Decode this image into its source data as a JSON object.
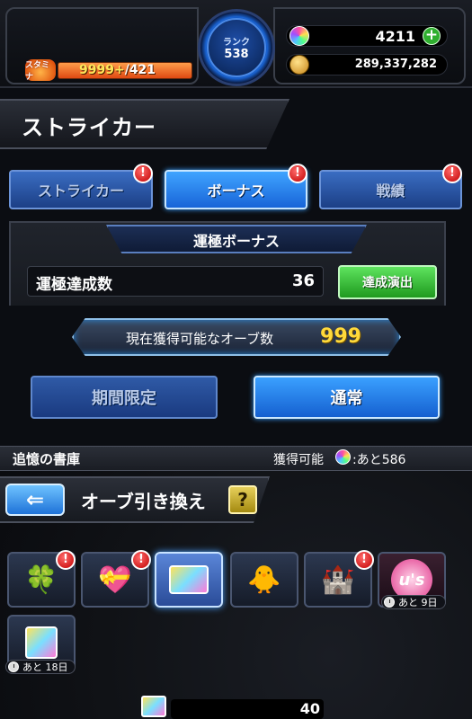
{
  "status": {
    "stamina_label": "スタミナ",
    "stamina_current": "9999+",
    "stamina_max": "/421",
    "rank_label": "ランク",
    "rank_value": "538",
    "orbs": "4211",
    "gold": "289,337,282"
  },
  "page": {
    "title": "ストライカー"
  },
  "tabs": [
    {
      "label": "ストライカー",
      "active": false,
      "badge": "!"
    },
    {
      "label": "ボーナス",
      "active": true,
      "badge": "!"
    },
    {
      "label": "戦績",
      "active": false,
      "badge": "!"
    }
  ],
  "bonus": {
    "header": "運極ボーナス",
    "row_label": "運極達成数",
    "row_value": "36",
    "show_button": "達成演出"
  },
  "orb_banner": {
    "label": "現在獲得可能なオーブ数",
    "value": "999"
  },
  "period_buttons": {
    "limited": "期間限定",
    "normal": "通常",
    "active": "normal"
  },
  "archive": {
    "title": "追憶の書庫",
    "obtainable_label": "獲得可能",
    "remaining": ":あと586"
  },
  "exchange": {
    "back_arrow": "⇐",
    "title": "オーブ引き換え",
    "help": "?",
    "tiles": [
      {
        "icon": "clover-hat-icon",
        "glyph": "🍀",
        "badge": "!",
        "active": false,
        "timer": ""
      },
      {
        "icon": "heart-item-icon",
        "glyph": "💝",
        "badge": "!",
        "active": false,
        "timer": ""
      },
      {
        "icon": "orb-card-icon",
        "glyph": "",
        "badge": "",
        "active": true,
        "timer": ""
      },
      {
        "icon": "mascot-character-icon",
        "glyph": "🐥",
        "badge": "",
        "active": false,
        "timer": ""
      },
      {
        "icon": "castle-item-icon",
        "glyph": "🏰",
        "badge": "!",
        "active": false,
        "timer": ""
      },
      {
        "icon": "us-logo-icon",
        "glyph": "",
        "badge": "",
        "active": false,
        "timer": "あと 9日",
        "logo_text": "u's"
      },
      {
        "icon": "character-orb-icon",
        "glyph": "",
        "badge": "",
        "active": false,
        "timer": "あと 18日"
      }
    ],
    "bottom_value": "40"
  },
  "colors": {
    "tab_active": "#1764d8",
    "tab_inactive": "#1c3f86",
    "badge": "#c00000",
    "orb_count": "#ffd93a",
    "show_button": "#1f9a1f"
  }
}
